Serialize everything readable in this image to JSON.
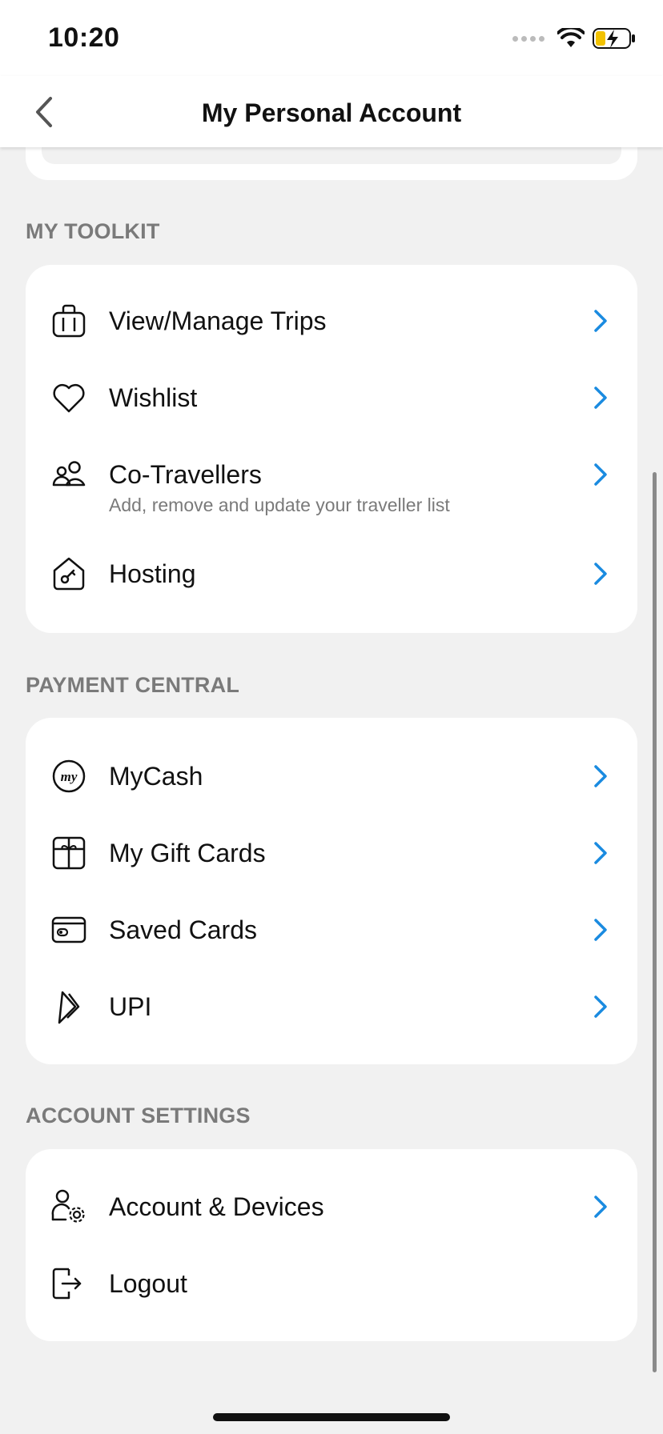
{
  "status_bar": {
    "time": "10:20"
  },
  "nav": {
    "title": "My Personal Account"
  },
  "sections": {
    "toolkit": {
      "header": "MY TOOLKIT",
      "items": [
        {
          "label": "View/Manage Trips",
          "icon": "briefcase-icon"
        },
        {
          "label": "Wishlist",
          "icon": "heart-icon"
        },
        {
          "label": "Co-Travellers",
          "subtitle": "Add, remove and update your traveller list",
          "icon": "people-icon"
        },
        {
          "label": "Hosting",
          "icon": "house-key-icon"
        }
      ]
    },
    "payment": {
      "header": "PAYMENT CENTRAL",
      "items": [
        {
          "label": "MyCash",
          "icon": "mycash-icon"
        },
        {
          "label": "My Gift Cards",
          "icon": "gift-card-icon"
        },
        {
          "label": "Saved Cards",
          "icon": "credit-card-icon"
        },
        {
          "label": "UPI",
          "icon": "upi-icon"
        }
      ]
    },
    "account": {
      "header": "ACCOUNT SETTINGS",
      "items": [
        {
          "label": "Account & Devices",
          "icon": "user-gear-icon"
        },
        {
          "label": "Logout",
          "icon": "logout-icon"
        }
      ]
    }
  },
  "colors": {
    "accent": "#1a8be0",
    "background": "#f1f1f1",
    "section_header": "#7a7a7a"
  }
}
